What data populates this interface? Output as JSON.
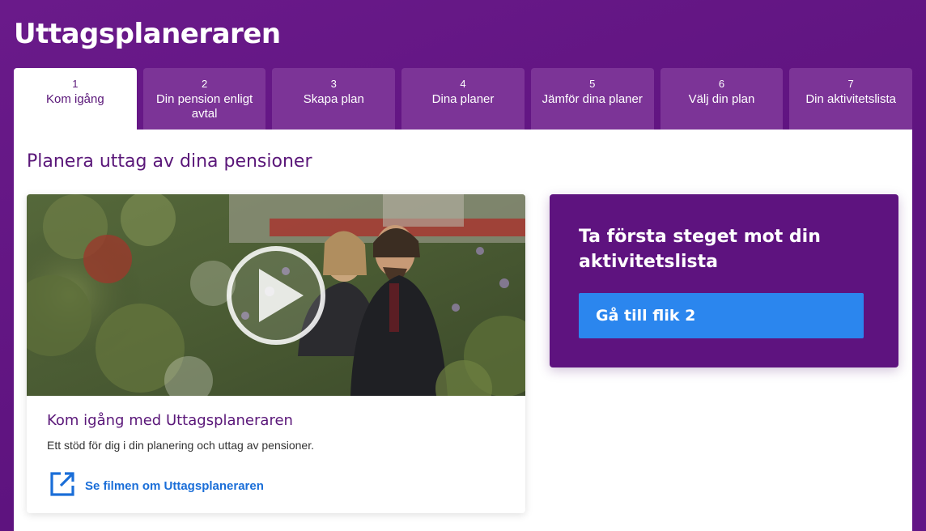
{
  "app": {
    "title": "Uttagsplaneraren"
  },
  "tabs": [
    {
      "number": "1",
      "label": "Kom igång",
      "active": true
    },
    {
      "number": "2",
      "label": "Din pension enligt avtal",
      "active": false
    },
    {
      "number": "3",
      "label": "Skapa plan",
      "active": false
    },
    {
      "number": "4",
      "label": "Dina planer",
      "active": false
    },
    {
      "number": "5",
      "label": "Jämför dina planer",
      "active": false
    },
    {
      "number": "6",
      "label": "Välj din plan",
      "active": false
    },
    {
      "number": "7",
      "label": "Din aktivitetslista",
      "active": false
    }
  ],
  "main": {
    "title": "Planera uttag av dina pensioner",
    "video_card": {
      "title": "Kom igång med Uttagsplaneraren",
      "description": "Ett stöd för dig i din planering och uttag av pensioner.",
      "link_label": "Se filmen om Uttagsplaneraren",
      "link_icon": "external-link-icon",
      "thumbnail_icon": "play-icon"
    },
    "cta": {
      "text": "Ta första steget mot din aktivitetslista",
      "button_label": "Gå till flik 2"
    }
  },
  "colors": {
    "brand_purple": "#5e137f",
    "tab_inactive": "#7c3497",
    "accent_blue": "#2b86ee",
    "link_blue": "#1a6ed8"
  }
}
